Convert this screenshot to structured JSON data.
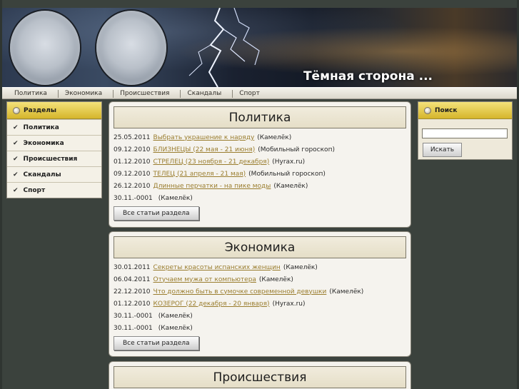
{
  "site": {
    "title": "Тёмная сторона ..."
  },
  "topnav": [
    "Политика",
    "Экономика",
    "Происшествия",
    "Скандалы",
    "Спорт"
  ],
  "left_sidebar": {
    "heading": "Разделы",
    "items": [
      "Политика",
      "Экономика",
      "Происшествия",
      "Скандалы",
      "Спорт"
    ]
  },
  "right_sidebar": {
    "heading": "Поиск",
    "search_value": "",
    "search_button": "Искать"
  },
  "sections": [
    {
      "title": "Политика",
      "button": "Все статьи раздела",
      "items": [
        {
          "date": "25.05.2011",
          "title": "Выбрать украшение к наряду",
          "source": "(Камелёк)"
        },
        {
          "date": "09.12.2010",
          "title": "БЛИЗНЕЦЫ (22 мая - 21 июня)",
          "source": "(Мобильный гороскоп)"
        },
        {
          "date": "01.12.2010",
          "title": "СТРЕЛЕЦ (23 ноября - 21 декабря)",
          "source": "(Hyrax.ru)"
        },
        {
          "date": "09.12.2010",
          "title": "ТЕЛЕЦ (21 апреля - 21 мая)",
          "source": "(Мобильный гороскоп)"
        },
        {
          "date": "26.12.2010",
          "title": "Длинные перчатки - на пике моды",
          "source": "(Камелёк)"
        },
        {
          "date": "30.11.-0001",
          "title": "",
          "source": "(Камелёк)"
        }
      ]
    },
    {
      "title": "Экономика",
      "button": "Все статьи раздела",
      "items": [
        {
          "date": "30.01.2011",
          "title": "Секреты красоты испанских женщин",
          "source": "(Камелёк)"
        },
        {
          "date": "06.04.2011",
          "title": "Отучаем мужа от компьютера",
          "source": "(Камелёк)"
        },
        {
          "date": "22.12.2010",
          "title": "Что должно быть в сумочке современной девушки",
          "source": "(Камелёк)"
        },
        {
          "date": "01.12.2010",
          "title": "КОЗЕРОГ (22 декабря - 20 января)",
          "source": "(Hyrax.ru)"
        },
        {
          "date": "30.11.-0001",
          "title": "",
          "source": "(Камелёк)"
        },
        {
          "date": "30.11.-0001",
          "title": "",
          "source": "(Камелёк)"
        }
      ]
    },
    {
      "title": "Происшествия"
    }
  ]
}
